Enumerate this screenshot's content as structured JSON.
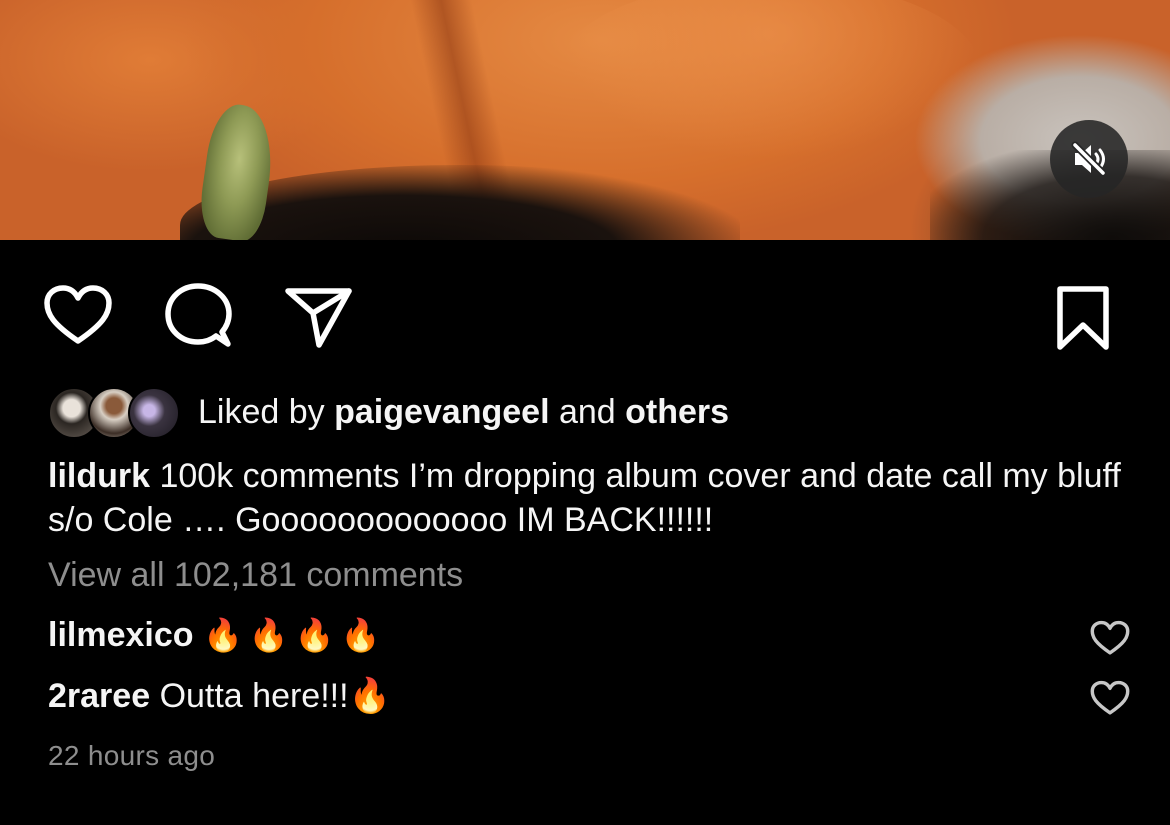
{
  "post": {
    "media": {
      "sound_state": "muted",
      "sound_icon": "speaker-muted-icon"
    },
    "actions": {
      "like_icon": "heart-icon",
      "comment_icon": "comment-bubble-icon",
      "share_icon": "paper-plane-icon",
      "save_icon": "bookmark-icon"
    },
    "likes": {
      "prefix": "Liked by",
      "user": "paigevangeel",
      "middle": "and",
      "suffix": "others"
    },
    "caption": {
      "username": "lildurk",
      "text": "100k comments I’m dropping album cover and date call my bluff s/o Cole …. Gooooooooooooo  IM BACK!!!!!!"
    },
    "view_all_comments": "View all 102,181 comments",
    "comments": [
      {
        "username": "lilmexico",
        "text": "🔥🔥🔥🔥"
      },
      {
        "username": "2raree",
        "text": "Outta here!!!🔥"
      }
    ],
    "timestamp": "22 hours ago"
  }
}
